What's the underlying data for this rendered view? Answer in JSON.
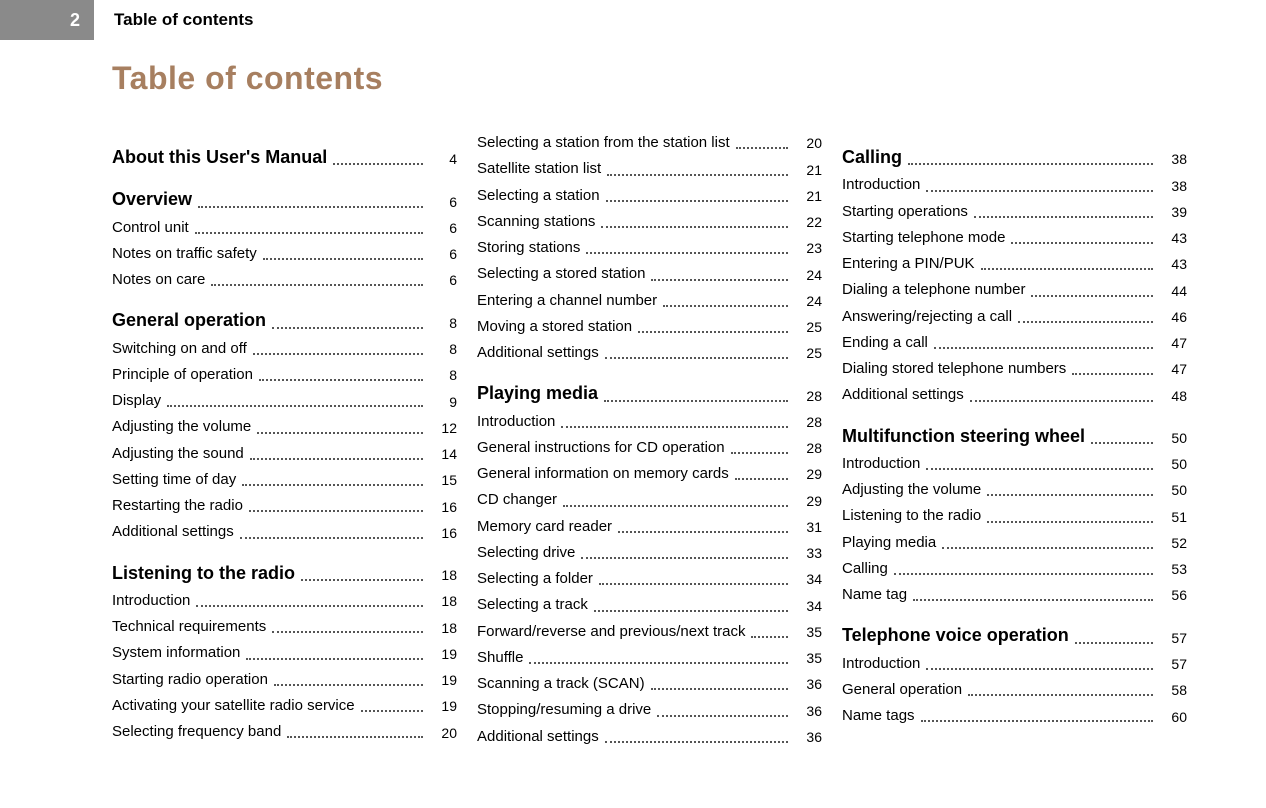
{
  "header": {
    "page_number": "2",
    "running_title": "Table of contents"
  },
  "main_title": "Table of contents",
  "columns": [
    {
      "sections": [
        {
          "title": "About this User's Manual",
          "page": "4",
          "entries": []
        },
        {
          "title": "Overview",
          "page": "6",
          "entries": [
            {
              "label": "Control unit",
              "page": "6"
            },
            {
              "label": "Notes on traffic safety",
              "page": "6"
            },
            {
              "label": "Notes on care",
              "page": "6"
            }
          ]
        },
        {
          "title": "General operation",
          "page": "8",
          "entries": [
            {
              "label": "Switching on and off",
              "page": "8"
            },
            {
              "label": "Principle of operation",
              "page": "8"
            },
            {
              "label": "Display",
              "page": "9"
            },
            {
              "label": "Adjusting the volume",
              "page": "12"
            },
            {
              "label": "Adjusting the sound",
              "page": "14"
            },
            {
              "label": "Setting time of day",
              "page": "15"
            },
            {
              "label": "Restarting the radio",
              "page": "16"
            },
            {
              "label": "Additional settings",
              "page": "16"
            }
          ]
        },
        {
          "title": "Listening to the radio",
          "page": "18",
          "entries": [
            {
              "label": "Introduction",
              "page": "18"
            },
            {
              "label": "Technical requirements",
              "page": "18"
            },
            {
              "label": "System information",
              "page": "19"
            },
            {
              "label": "Starting radio operation",
              "page": "19"
            },
            {
              "label": "Activating your satellite radio service",
              "page": "19"
            },
            {
              "label": "Selecting frequency band",
              "page": "20"
            }
          ]
        }
      ]
    },
    {
      "sections": [
        {
          "title": null,
          "page": null,
          "entries": [
            {
              "label": "Selecting a station from the station list",
              "page": "20"
            },
            {
              "label": "Satellite station list",
              "page": "21"
            },
            {
              "label": "Selecting a station",
              "page": "21"
            },
            {
              "label": "Scanning stations",
              "page": "22"
            },
            {
              "label": "Storing stations",
              "page": "23"
            },
            {
              "label": "Selecting a stored station",
              "page": "24"
            },
            {
              "label": "Entering a channel number",
              "page": "24"
            },
            {
              "label": "Moving a stored station",
              "page": "25"
            },
            {
              "label": "Additional settings",
              "page": "25"
            }
          ]
        },
        {
          "title": "Playing media",
          "page": "28",
          "entries": [
            {
              "label": "Introduction",
              "page": "28"
            },
            {
              "label": "General instructions for CD operation",
              "page": "28"
            },
            {
              "label": "General information on memory cards",
              "page": "29"
            },
            {
              "label": "CD changer",
              "page": "29"
            },
            {
              "label": "Memory card reader",
              "page": "31"
            },
            {
              "label": "Selecting drive",
              "page": "33"
            },
            {
              "label": "Selecting a folder",
              "page": "34"
            },
            {
              "label": "Selecting a track",
              "page": "34"
            },
            {
              "label": "Forward/reverse and previous/next track",
              "page": "35"
            },
            {
              "label": "Shuffle",
              "page": "35"
            },
            {
              "label": "Scanning a track (SCAN)",
              "page": "36"
            },
            {
              "label": "Stopping/resuming a drive",
              "page": "36"
            },
            {
              "label": "Additional settings",
              "page": "36"
            }
          ]
        }
      ]
    },
    {
      "sections": [
        {
          "title": "Calling",
          "page": "38",
          "entries": [
            {
              "label": "Introduction",
              "page": "38"
            },
            {
              "label": "Starting operations",
              "page": "39"
            },
            {
              "label": "Starting telephone mode",
              "page": "43"
            },
            {
              "label": "Entering a PIN/PUK",
              "page": "43"
            },
            {
              "label": "Dialing a telephone number",
              "page": "44"
            },
            {
              "label": "Answering/rejecting a call",
              "page": "46"
            },
            {
              "label": "Ending a call",
              "page": "47"
            },
            {
              "label": "Dialing stored telephone numbers",
              "page": "47"
            },
            {
              "label": "Additional settings",
              "page": "48"
            }
          ]
        },
        {
          "title": "Multifunction steering wheel",
          "page": "50",
          "entries": [
            {
              "label": "Introduction",
              "page": "50"
            },
            {
              "label": "Adjusting the volume",
              "page": "50"
            },
            {
              "label": "Listening to the radio",
              "page": "51"
            },
            {
              "label": "Playing media",
              "page": "52"
            },
            {
              "label": "Calling",
              "page": "53"
            },
            {
              "label": "Name tag",
              "page": "56"
            }
          ]
        },
        {
          "title": "Telephone voice operation",
          "page": "57",
          "entries": [
            {
              "label": "Introduction",
              "page": "57"
            },
            {
              "label": "General operation",
              "page": "58"
            },
            {
              "label": "Name tags",
              "page": "60"
            }
          ]
        }
      ]
    }
  ]
}
